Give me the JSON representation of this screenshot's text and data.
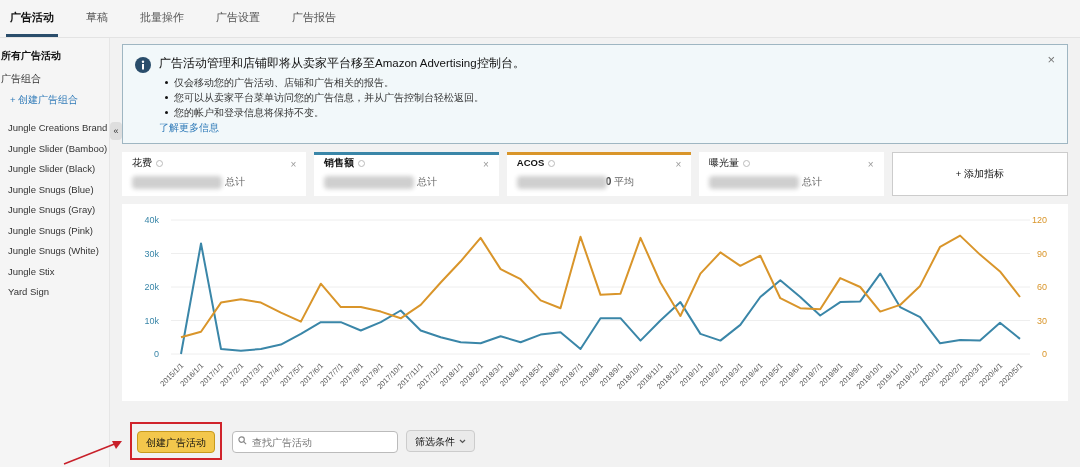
{
  "tabs": [
    {
      "label": "广告活动",
      "selected": true
    },
    {
      "label": "草稿",
      "selected": false
    },
    {
      "label": "批量操作",
      "selected": false
    },
    {
      "label": "广告设置",
      "selected": false
    },
    {
      "label": "广告报告",
      "selected": false
    }
  ],
  "sidebar": {
    "heading": "所有广告活动",
    "group_label": "广告组合",
    "create_link": "+ 创建广告组合",
    "items": [
      "Jungle Creations Brand",
      "Jungle Slider (Bamboo)",
      "Jungle Slider (Black)",
      "Jungle Snugs (Blue)",
      "Jungle Snugs (Gray)",
      "Jungle Snugs (Pink)",
      "Jungle Snugs (White)",
      "Jungle Stix",
      "Yard Sign"
    ],
    "collapse_label": "«"
  },
  "notice": {
    "title": "广告活动管理和店铺即将从卖家平台移至Amazon Advertising控制台。",
    "bullets": [
      "仅会移动您的广告活动、店铺和广告相关的报告。",
      "您可以从卖家平台菜单访问您的广告信息，并从广告控制台轻松返回。",
      "您的帐户和登录信息将保持不变。"
    ],
    "link": "了解更多信息",
    "close": "×"
  },
  "metrics": [
    {
      "label": "花费",
      "suffix": "总计",
      "close": "×"
    },
    {
      "label": "销售额",
      "suffix": "总计",
      "color": "#3a86a8",
      "close": "×"
    },
    {
      "label": "ACOS",
      "value_tail": "0",
      "suffix": "平均",
      "color": "#d9952a",
      "close": "×"
    },
    {
      "label": "曝光量",
      "suffix": "总计",
      "close": "×"
    }
  ],
  "add_metric": "+ 添加指标",
  "chart_data": {
    "type": "line",
    "categories": [
      "2015/1/1",
      "2016/1/1",
      "2017/1/1",
      "2017/2/1",
      "2017/3/1",
      "2017/4/1",
      "2017/5/1",
      "2017/6/1",
      "2017/7/1",
      "2017/8/1",
      "2017/9/1",
      "2017/10/1",
      "2017/11/1",
      "2017/12/1",
      "2018/1/1",
      "2018/2/1",
      "2018/3/1",
      "2018/4/1",
      "2018/5/1",
      "2018/6/1",
      "2018/7/1",
      "2018/8/1",
      "2018/9/1",
      "2018/10/1",
      "2018/11/1",
      "2018/12/1",
      "2019/1/1",
      "2019/2/1",
      "2019/3/1",
      "2019/4/1",
      "2019/5/1",
      "2019/6/1",
      "2019/7/1",
      "2019/8/1",
      "2019/9/1",
      "2019/10/1",
      "2019/11/1",
      "2019/12/1",
      "2020/1/1",
      "2020/2/1",
      "2020/3/1",
      "2020/4/1",
      "2020/5/1"
    ],
    "grid": true,
    "ylim": [
      0,
      40000
    ],
    "y2lim": [
      0,
      120
    ],
    "yticks": [
      0,
      {
        "value": 10000,
        "label": "10k"
      },
      {
        "value": 20000,
        "label": "20k"
      },
      {
        "value": 30000,
        "label": "30k"
      },
      {
        "value": 40000,
        "label": "40k"
      }
    ],
    "y2ticks": [
      0,
      30,
      60,
      90,
      120
    ],
    "series": [
      {
        "color": "#3a86a8",
        "values": [
          0,
          33000,
          1500,
          1000,
          1500,
          2800,
          6000,
          9500,
          9500,
          7000,
          9500,
          13000,
          7000,
          5000,
          3500,
          3200,
          5300,
          3500,
          5800,
          6500,
          1500,
          10700,
          10700,
          4000,
          10000,
          15500,
          6000,
          4000,
          8700,
          17000,
          22000,
          17000,
          11500,
          15500,
          15700,
          24000,
          14000,
          11000,
          3200,
          4200,
          4000,
          9300,
          4500
        ]
      },
      {
        "color": "#d9952a",
        "axis": "y2",
        "values": [
          15,
          20,
          46,
          49,
          46,
          37,
          29,
          63,
          42,
          42,
          38,
          32,
          44,
          64,
          83,
          104,
          76,
          67,
          48,
          41,
          105,
          53,
          54,
          104,
          64,
          34,
          72,
          91,
          79,
          88,
          50,
          41,
          40,
          68,
          60,
          38,
          44,
          61,
          96,
          106,
          89,
          74,
          51
        ]
      }
    ]
  },
  "toolbar": {
    "create_button": "创建广告活动",
    "highlighted": true,
    "search_placeholder": "查找广告活动",
    "filter": "筛选条件"
  }
}
